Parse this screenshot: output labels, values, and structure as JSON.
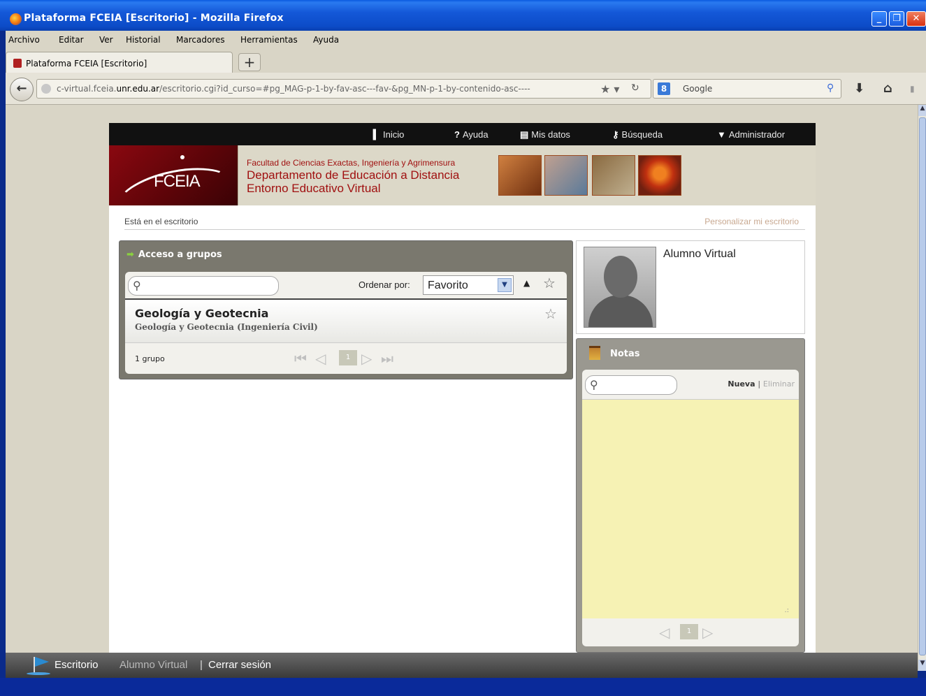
{
  "window": {
    "title": "Plataforma FCEIA [Escritorio] - Mozilla Firefox",
    "buttons": {
      "minimize": "_",
      "maximize": "❐",
      "close": "✕"
    }
  },
  "menubar": [
    "Archivo",
    "Editar",
    "Ver",
    "Historial",
    "Marcadores",
    "Herramientas",
    "Ayuda"
  ],
  "tab": {
    "label": "Plataforma FCEIA [Escritorio]",
    "new_tab": "+"
  },
  "navbar": {
    "url_prefix": "c-virtual.fceia.",
    "url_domain": "unr.edu.ar",
    "url_path": "/escritorio.cgi?id_curso=#pg_MAG-p-1-by-fav-asc---fav-&pg_MN-p-1-by-contenido-asc----",
    "search_placeholder": "Google"
  },
  "site_nav": {
    "inicio": "Inicio",
    "ayuda": "Ayuda",
    "mis_datos": "Mis datos",
    "busqueda": "Búsqueda",
    "administrador": "Administrador"
  },
  "banner": {
    "logo_text": "FCEIA",
    "line1": "Facultad de Ciencias Exactas, Ingeniería y Agrimensura",
    "line2": "Departamento de Educación a Distancia",
    "line3": "Entorno Educativo Virtual"
  },
  "breadcrumb": "Está en el escritorio",
  "customize_link": "Personalizar mi escritorio",
  "groups": {
    "header": "Acceso a grupos",
    "order_label": "Ordenar por:",
    "order_value": "Favorito",
    "items": [
      {
        "title": "Geología y Geotecnia",
        "subtitle": "Geología y Geotecnia (Ingeniería Civil)"
      }
    ],
    "count": "1 grupo",
    "current_page": "1"
  },
  "profile": {
    "name": "Alumno Virtual"
  },
  "notes": {
    "header": "Notas",
    "new_label": "Nueva",
    "separator": "|",
    "delete_label": "Eliminar",
    "current_page": "1"
  },
  "bottom_bar": {
    "escritorio": "Escritorio",
    "user": "Alumno Virtual",
    "separator": "|",
    "logout": "Cerrar sesión"
  }
}
